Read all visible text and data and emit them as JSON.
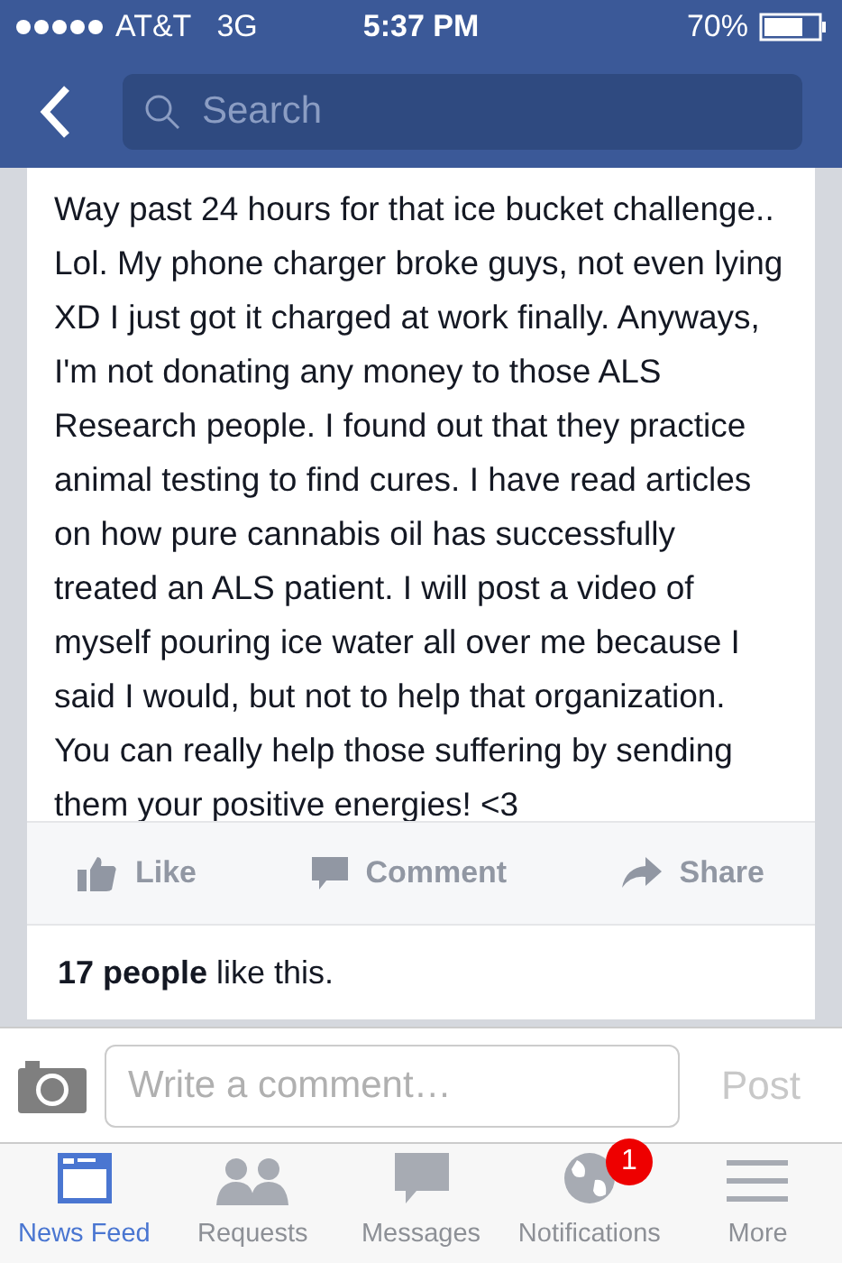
{
  "status_bar": {
    "carrier": "AT&T",
    "network": "3G",
    "time": "5:37 PM",
    "battery": "70%"
  },
  "nav_bar": {
    "search": {
      "placeholder": "Search"
    }
  },
  "post": {
    "text": "Way past 24 hours for that ice bucket challenge.. Lol. My phone charger broke guys, not even lying XD I just got it charged at work finally. Anyways, I'm not donating any money to those ALS Research people. I found out that they practice animal testing to find cures. I have read articles on how pure cannabis oil has successfully treated an ALS patient. I will post a video of myself pouring ice water all over me because I said I would, but not to help that organization. You can really help those suffering by sending them your positive energies! <3",
    "actions": [
      {
        "kind": "like",
        "label": "Like"
      },
      {
        "kind": "comment",
        "label": "Comment"
      },
      {
        "kind": "share",
        "label": "Share"
      }
    ],
    "likes": "**17 people** like this."
  },
  "comment_bar": {
    "placeholder": "Write a comment…",
    "post_button": "Post"
  },
  "tab_bar": [
    {
      "kind": "feed",
      "label": "News Feed",
      "selected": true
    },
    {
      "kind": "requests",
      "label": "Requests",
      "selected": false
    },
    {
      "kind": "messages",
      "label": "Messages",
      "selected": false
    },
    {
      "kind": "notifications",
      "label": "Notifications",
      "selected": false,
      "badge": "1"
    },
    {
      "kind": "more",
      "label": "More",
      "selected": false
    }
  ]
}
